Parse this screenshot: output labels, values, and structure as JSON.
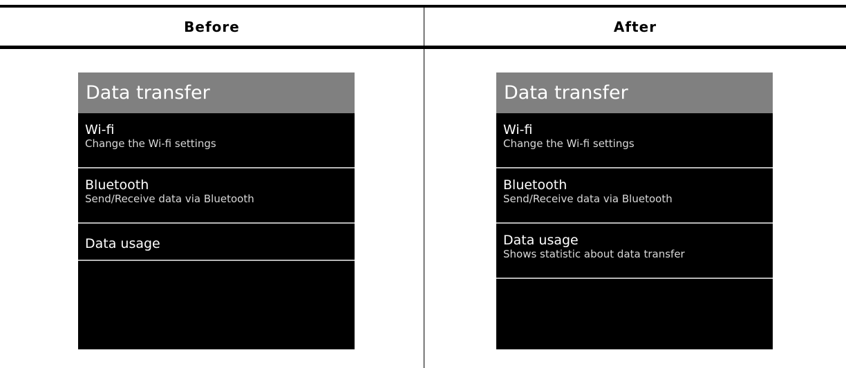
{
  "headers": {
    "before": "Before",
    "after": "After"
  },
  "before_screen": {
    "title": "Data transfer",
    "items": [
      {
        "title": "Wi-fi",
        "description": "Change the Wi-fi settings"
      },
      {
        "title": "Bluetooth",
        "description": "Send/Receive data via Bluetooth"
      },
      {
        "title": "Data usage",
        "description": ""
      }
    ]
  },
  "after_screen": {
    "title": "Data transfer",
    "items": [
      {
        "title": "Wi-fi",
        "description": "Change the Wi-fi settings"
      },
      {
        "title": "Bluetooth",
        "description": "Send/Receive data via Bluetooth"
      },
      {
        "title": "Data usage",
        "description": "Shows statistic about data transfer"
      }
    ]
  },
  "colors": {
    "title_bar": "#808080",
    "screen_background": "#000000",
    "separator": "#b8b8b8"
  }
}
